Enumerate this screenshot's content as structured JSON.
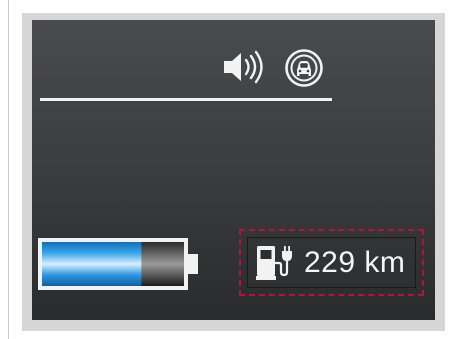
{
  "display": {
    "range_value": "229",
    "range_unit": "km"
  },
  "battery": {
    "charge_level": 0.7
  },
  "icons": {
    "sound": "speaker-icon",
    "traffic": "vehicle-detection-icon",
    "charging": "charging-station-icon"
  },
  "colors": {
    "screen_background": "#3d3e40",
    "battery_fill": "#1e90e8",
    "highlight_border": "#b0153b",
    "foreground": "#f5f5f5"
  }
}
